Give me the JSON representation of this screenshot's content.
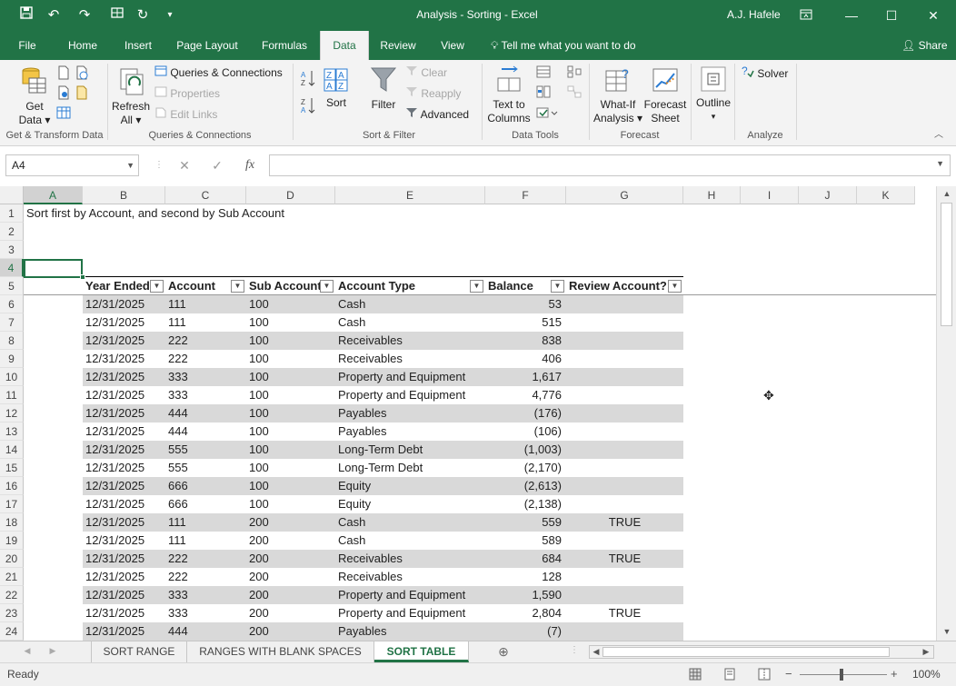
{
  "window": {
    "title": "Analysis - Sorting  -  Excel",
    "user": "A.J. Hafele"
  },
  "tabs": [
    "File",
    "Home",
    "Insert",
    "Page Layout",
    "Formulas",
    "Data",
    "Review",
    "View"
  ],
  "active_tab": "Data",
  "tellme": "Tell me what you want to do",
  "share": "Share",
  "ribbon": {
    "get_data": [
      "Get",
      "Data"
    ],
    "refresh_all": [
      "Refresh",
      "All"
    ],
    "queries_connections": "Queries & Connections",
    "properties": "Properties",
    "edit_links": "Edit Links",
    "sort": "Sort",
    "filter": "Filter",
    "clear": "Clear",
    "reapply": "Reapply",
    "advanced": "Advanced",
    "text_to_columns": [
      "Text to",
      "Columns"
    ],
    "what_if": [
      "What-If",
      "Analysis"
    ],
    "forecast_sheet": [
      "Forecast",
      "Sheet"
    ],
    "outline": "Outline",
    "solver": "Solver",
    "groups": {
      "get_transform": "Get & Transform Data",
      "queries": "Queries & Connections",
      "sort_filter": "Sort & Filter",
      "data_tools": "Data Tools",
      "forecast": "Forecast",
      "analyze": "Analyze"
    }
  },
  "formula_bar": {
    "name_box": "A4",
    "fx": "fx",
    "value": ""
  },
  "columns": [
    "A",
    "B",
    "C",
    "D",
    "E",
    "F",
    "G",
    "H",
    "I",
    "J",
    "K"
  ],
  "note": "Sort first by Account, and second by Sub Account",
  "table": {
    "headers": [
      "Year Ended",
      "Account",
      "Sub Account",
      "Account Type",
      "Balance",
      "Review Account?"
    ],
    "rows": [
      [
        "12/31/2025",
        "111",
        "100",
        "Cash",
        "53",
        ""
      ],
      [
        "12/31/2025",
        "111",
        "100",
        "Cash",
        "515",
        ""
      ],
      [
        "12/31/2025",
        "222",
        "100",
        "Receivables",
        "838",
        ""
      ],
      [
        "12/31/2025",
        "222",
        "100",
        "Receivables",
        "406",
        ""
      ],
      [
        "12/31/2025",
        "333",
        "100",
        "Property and Equipment",
        "1,617",
        ""
      ],
      [
        "12/31/2025",
        "333",
        "100",
        "Property and Equipment",
        "4,776",
        ""
      ],
      [
        "12/31/2025",
        "444",
        "100",
        "Payables",
        "(176)",
        ""
      ],
      [
        "12/31/2025",
        "444",
        "100",
        "Payables",
        "(106)",
        ""
      ],
      [
        "12/31/2025",
        "555",
        "100",
        "Long-Term Debt",
        "(1,003)",
        ""
      ],
      [
        "12/31/2025",
        "555",
        "100",
        "Long-Term Debt",
        "(2,170)",
        ""
      ],
      [
        "12/31/2025",
        "666",
        "100",
        "Equity",
        "(2,613)",
        ""
      ],
      [
        "12/31/2025",
        "666",
        "100",
        "Equity",
        "(2,138)",
        ""
      ],
      [
        "12/31/2025",
        "111",
        "200",
        "Cash",
        "559",
        "TRUE"
      ],
      [
        "12/31/2025",
        "111",
        "200",
        "Cash",
        "589",
        ""
      ],
      [
        "12/31/2025",
        "222",
        "200",
        "Receivables",
        "684",
        "TRUE"
      ],
      [
        "12/31/2025",
        "222",
        "200",
        "Receivables",
        "128",
        ""
      ],
      [
        "12/31/2025",
        "333",
        "200",
        "Property and Equipment",
        "1,590",
        ""
      ],
      [
        "12/31/2025",
        "333",
        "200",
        "Property and Equipment",
        "2,804",
        "TRUE"
      ],
      [
        "12/31/2025",
        "444",
        "200",
        "Payables",
        "(7)",
        ""
      ]
    ]
  },
  "sheets": [
    "SORT RANGE",
    "RANGES WITH BLANK SPACES",
    "SORT TABLE"
  ],
  "active_sheet": "SORT TABLE",
  "status": "Ready",
  "zoom": "100%",
  "colors": {
    "accent": "#217346",
    "band": "#d9d9d9"
  }
}
